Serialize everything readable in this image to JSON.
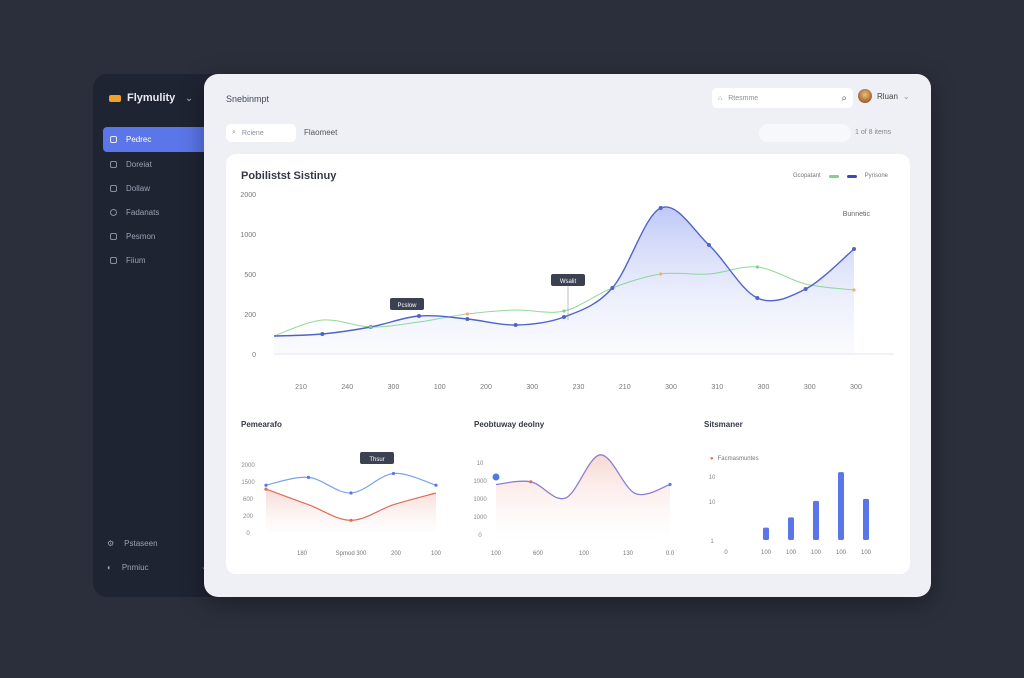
{
  "sidebar": {
    "brand": "Flymulity",
    "items": [
      {
        "label": "Pedrec",
        "active": true
      },
      {
        "label": "Doreiat",
        "active": false
      },
      {
        "label": "Dollaw",
        "active": false
      },
      {
        "label": "Fadanats",
        "active": false,
        "caret": true
      },
      {
        "label": "Pesmon",
        "active": false
      },
      {
        "label": "Fiium",
        "active": false,
        "caret": true
      }
    ],
    "bottom": [
      {
        "label": "Pstaseen",
        "caret": false
      },
      {
        "label": "Pnmiuc",
        "caret": true
      }
    ]
  },
  "header": {
    "title": "Snebinmpt",
    "search_placeholder": "Rtesmme",
    "user_name": "Rluan"
  },
  "toolbar": {
    "filter_placeholder": "Rciene",
    "filter_label": "Flaomeet",
    "pager": "1 of 8 items"
  },
  "main_chart": {
    "title": "Pobilistst Sistinuy",
    "legend": [
      "Gcopatant",
      "Pyrisone"
    ],
    "y_ticks": [
      "0",
      "200",
      "500",
      "1000",
      "2000"
    ],
    "x_ticks": [
      "210",
      "240",
      "300",
      "100",
      "200",
      "300",
      "230",
      "210",
      "300",
      "310",
      "300",
      "300",
      "300"
    ],
    "tooltip_a": "Pcslow",
    "tooltip_b": "Wsalit",
    "corner_label": "Bunnetic"
  },
  "chart_data": [
    {
      "type": "area",
      "title": "Pobilistst Sistinuy",
      "series": [
        {
          "name": "Pyrisone",
          "values": [
            90,
            100,
            135,
            190,
            175,
            145,
            185,
            330,
            730,
            545,
            280,
            325,
            525
          ]
        },
        {
          "name": "Gcopatant",
          "values": [
            90,
            170,
            135,
            160,
            200,
            220,
            215,
            330,
            400,
            400,
            435,
            350,
            320
          ]
        }
      ],
      "colors": [
        "#5b6fd6",
        "#7fd28a",
        "#f3b06b"
      ]
    },
    {
      "type": "line",
      "title": "Pemearafo",
      "x_ticks": [
        "180",
        "Spmod 300",
        "200",
        "100"
      ],
      "y_ticks": [
        "0",
        "200",
        "600",
        "1500",
        "2000"
      ],
      "series": [
        {
          "name": "a",
          "values": [
            1200,
            1400,
            1000,
            1500,
            1200
          ]
        },
        {
          "name": "b",
          "values": [
            1100,
            700,
            300,
            700,
            1000
          ]
        }
      ],
      "tooltip": "Thsur"
    },
    {
      "type": "area",
      "title": "Peobtuway deolny",
      "x_ticks": [
        "100",
        "600",
        "100",
        "130",
        "0.0"
      ],
      "y_ticks": [
        "0",
        "1000",
        "1000",
        "1000",
        "10"
      ],
      "series": [
        {
          "name": "a",
          "values": [
            0.55,
            0.58,
            0.4,
            0.88,
            0.45,
            0.55
          ]
        }
      ]
    },
    {
      "type": "bar",
      "title": "Sitsmaner",
      "legend": "Facmasmuntes",
      "categories": [
        "0",
        "100",
        "100",
        "100",
        "100",
        "100"
      ],
      "y_ticks": [
        "1",
        "10",
        "10"
      ],
      "values": [
        0,
        12,
        22,
        38,
        66,
        40
      ]
    }
  ],
  "colors": {
    "accent": "#5b76e8",
    "green": "#7fd28a",
    "orange": "#f3b06b",
    "red": "#e26b5a"
  }
}
